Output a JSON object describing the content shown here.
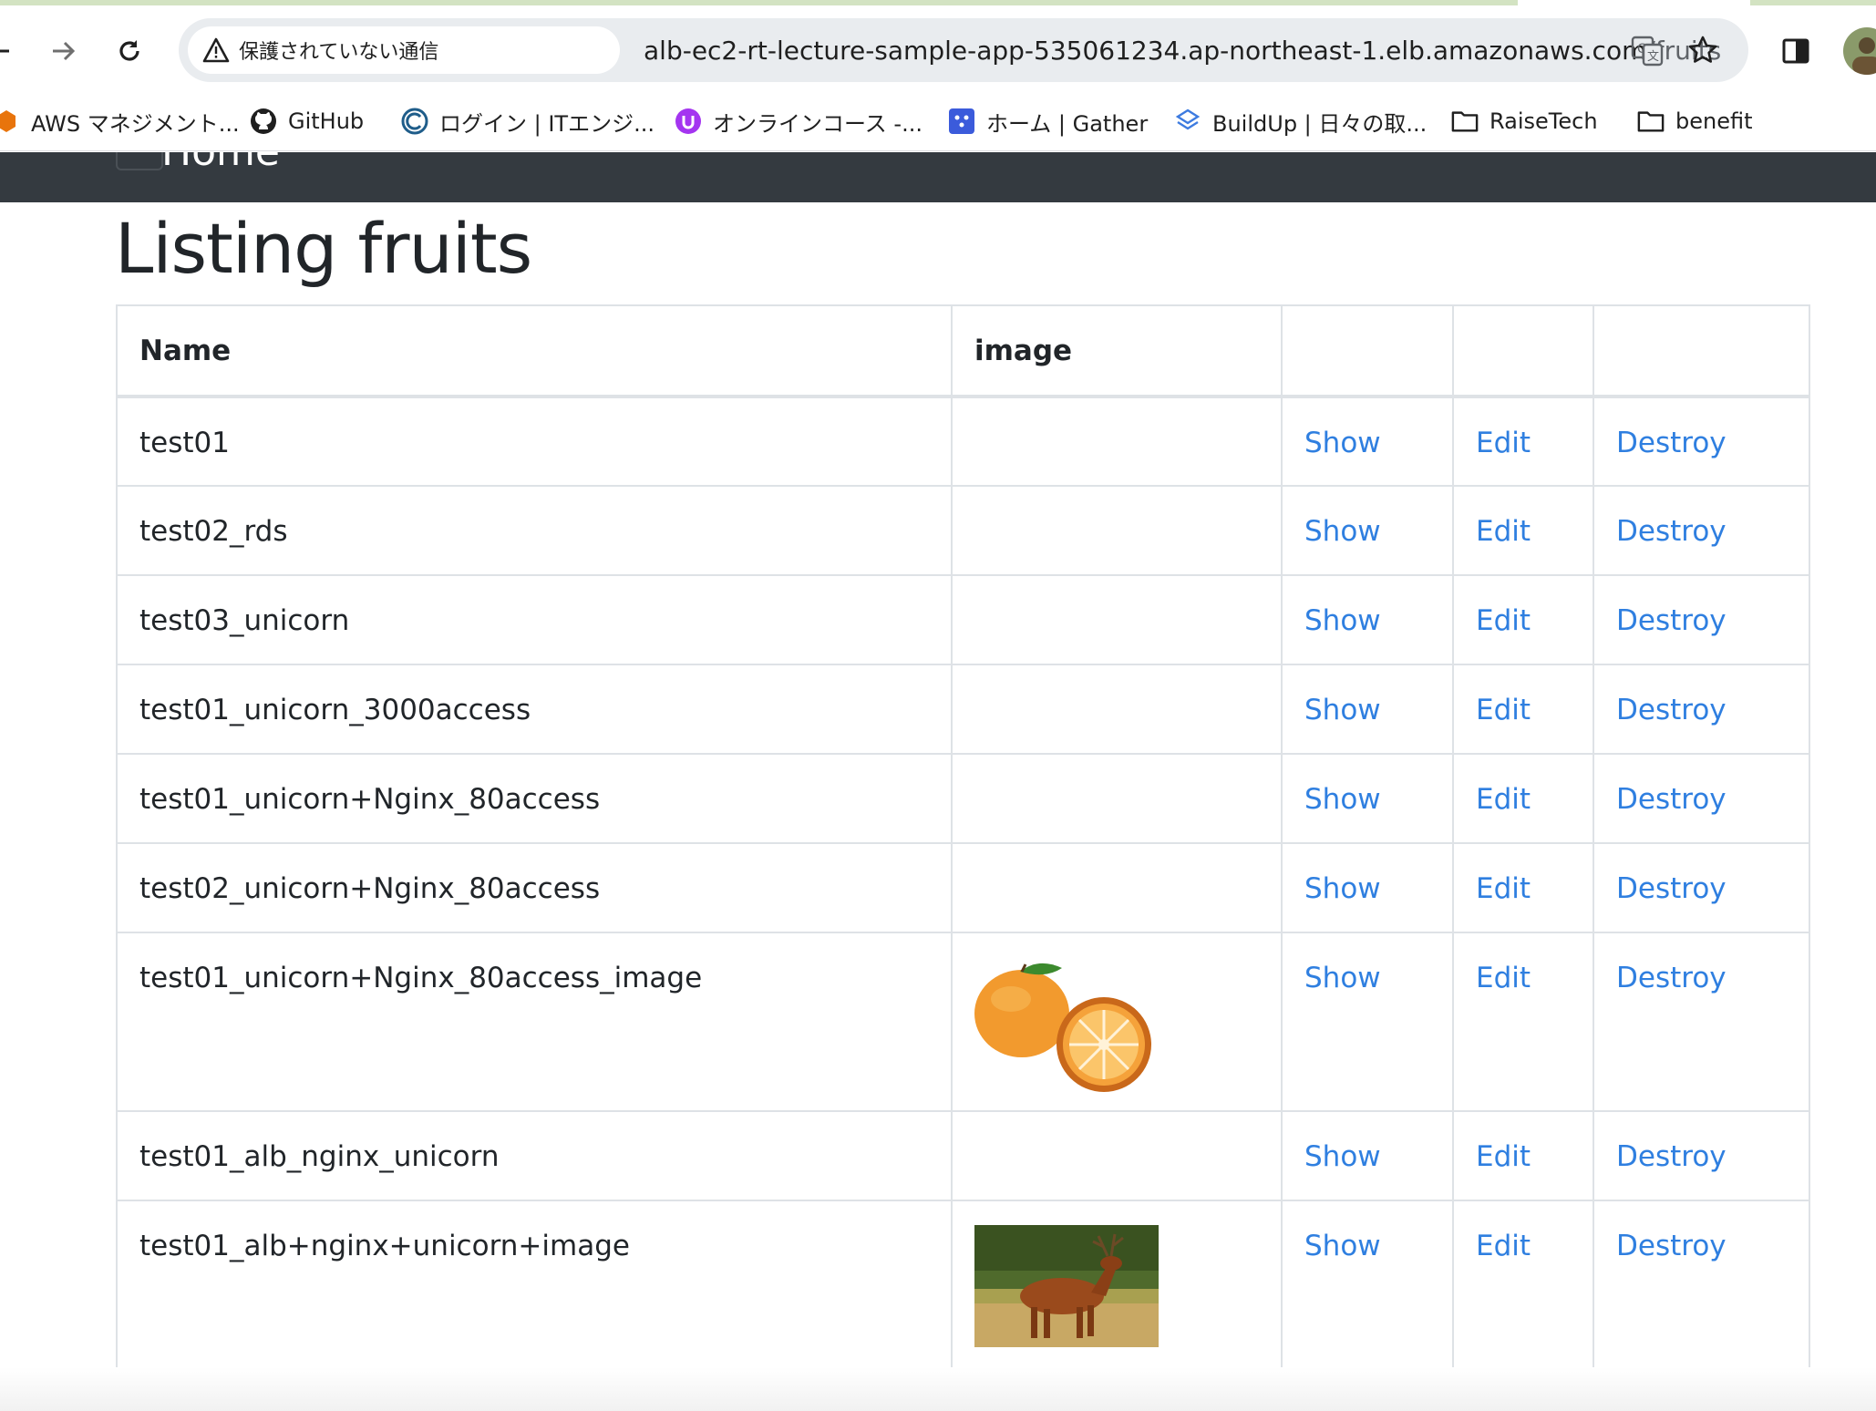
{
  "browser": {
    "security_label": "保護されていない通信",
    "url_host": "alb-ec2-rt-lecture-sample-app-535061234.ap-northeast-1.elb.amazonaws.com",
    "url_path": "/fruits",
    "bookmarks": [
      {
        "label": "AWS マネジメント...",
        "icon": "aws-icon"
      },
      {
        "label": "GitHub",
        "icon": "github-icon"
      },
      {
        "label": "ログイン | ITエンジ...",
        "icon": "globe-icon"
      },
      {
        "label": "オンラインコース -...",
        "icon": "udemy-icon"
      },
      {
        "label": "ホーム | Gather",
        "icon": "gather-icon"
      },
      {
        "label": "BuildUp | 日々の取...",
        "icon": "buildup-icon"
      },
      {
        "label": "RaiseTech",
        "icon": "folder-icon"
      },
      {
        "label": "benefit",
        "icon": "folder-icon"
      }
    ]
  },
  "navbar": {
    "home_label": "Home"
  },
  "page": {
    "title": "Listing fruits"
  },
  "table": {
    "headers": [
      "Name",
      "image",
      "",
      "",
      ""
    ],
    "action_labels": {
      "show": "Show",
      "edit": "Edit",
      "destroy": "Destroy"
    },
    "rows": [
      {
        "name": "test01",
        "image": ""
      },
      {
        "name": "test02_rds",
        "image": ""
      },
      {
        "name": "test03_unicorn",
        "image": ""
      },
      {
        "name": "test01_unicorn_3000access",
        "image": ""
      },
      {
        "name": "test01_unicorn+Nginx_80access",
        "image": ""
      },
      {
        "name": "test02_unicorn+Nginx_80access",
        "image": ""
      },
      {
        "name": "test01_unicorn+Nginx_80access_image",
        "image": "orange-image"
      },
      {
        "name": "test01_alb_nginx_unicorn",
        "image": ""
      },
      {
        "name": "test01_alb+nginx+unicorn+image",
        "image": "deer-image"
      }
    ]
  },
  "colors": {
    "navbar": "#343a40",
    "link": "#2f7fe0",
    "border": "#dee2e6"
  }
}
